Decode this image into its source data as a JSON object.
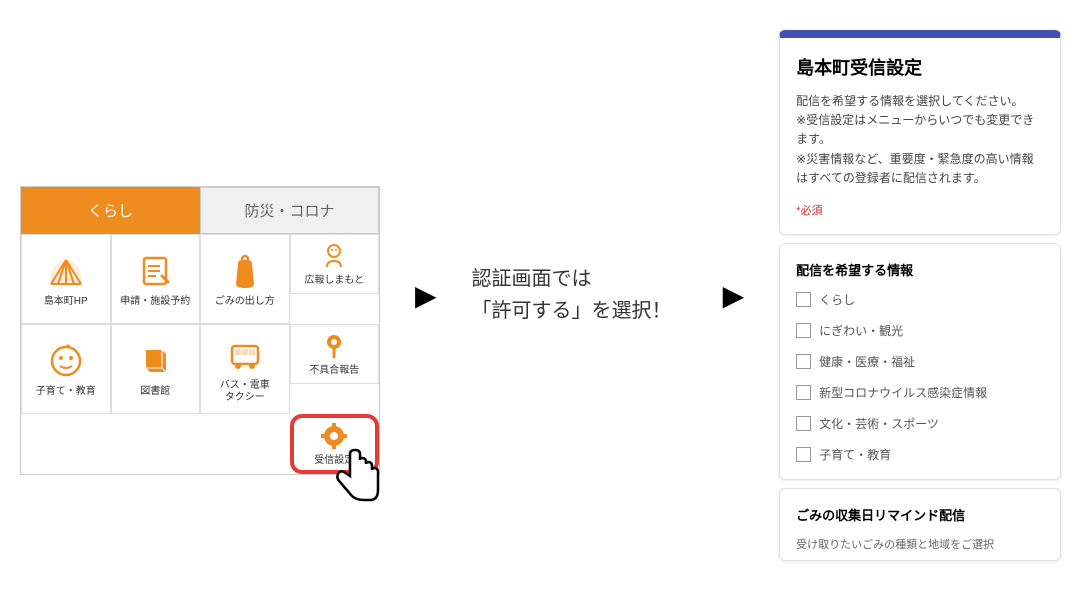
{
  "app_panel": {
    "tabs": {
      "active": "くらし",
      "inactive": "防災・コロナ"
    },
    "grid_items": [
      {
        "label": "島本町HP",
        "icon": "fan"
      },
      {
        "label": "申請・施設予約",
        "icon": "form"
      },
      {
        "label": "ごみの出し方",
        "icon": "trash"
      },
      {
        "label": "広報しまもと",
        "icon": "person"
      },
      {
        "label": "子育て・教育",
        "icon": "baby"
      },
      {
        "label": "図書館",
        "icon": "book"
      },
      {
        "label": "バス・電車\nタクシー",
        "icon": "bus"
      },
      {
        "label": "不具合報告",
        "icon": "pin"
      },
      {
        "label": "受信設定",
        "icon": "gear",
        "highlighted": true
      }
    ]
  },
  "middle_text_line1": "認証画面では",
  "middle_text_line2": "「許可する」を選択！",
  "form": {
    "title": "島本町受信設定",
    "desc": "配信を希望する情報を選択してください。\n※受信設定はメニューからいつでも変更できます。\n※災害情報など、重要度・緊急度の高い情報はすべての登録者に配信されます。",
    "required_label": "*必須",
    "section1_title": "配信を希望する情報",
    "checkboxes": [
      "くらし",
      "にぎわい・観光",
      "健康・医療・福祉",
      "新型コロナウイルス感染症情報",
      "文化・芸術・スポーツ",
      "子育て・教育"
    ],
    "section2_title": "ごみの収集日リマインド配信",
    "section2_desc": "受け取りたいごみの種類と地域をご選択"
  }
}
